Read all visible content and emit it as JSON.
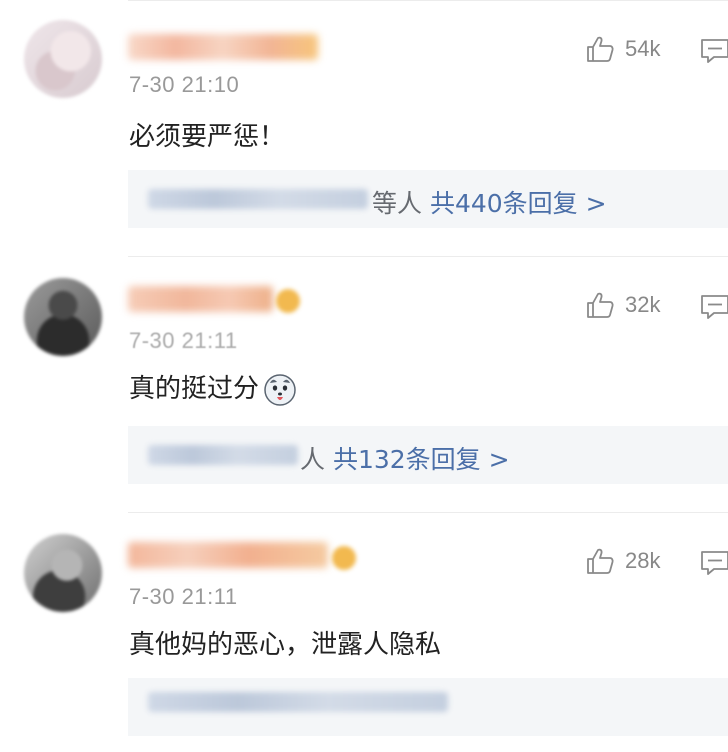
{
  "comments": [
    {
      "time": "7-30 21:10",
      "text": "必须要严惩！",
      "likes": "54k",
      "reply_suffix": "等人",
      "reply_count": "共440条回复 >",
      "icons": [
        "thumbs-up-icon",
        "reply-icon"
      ]
    },
    {
      "time": "7-30 21:11",
      "text": "真的挺过分",
      "likes": "32k",
      "reply_suffix": "人",
      "reply_count": "共132条回复 >",
      "emoji": "husky-emoji",
      "icons": [
        "thumbs-up-icon",
        "reply-icon"
      ]
    },
    {
      "time": "7-30 21:11",
      "text": "真他妈的恶心，泄露人隐私",
      "likes": "28k",
      "icons": [
        "thumbs-up-icon",
        "reply-icon"
      ]
    }
  ],
  "colors": {
    "link_blue": "#4b6fa8",
    "timestamp_gray": "#999999",
    "reply_bg": "#f4f6f8"
  }
}
